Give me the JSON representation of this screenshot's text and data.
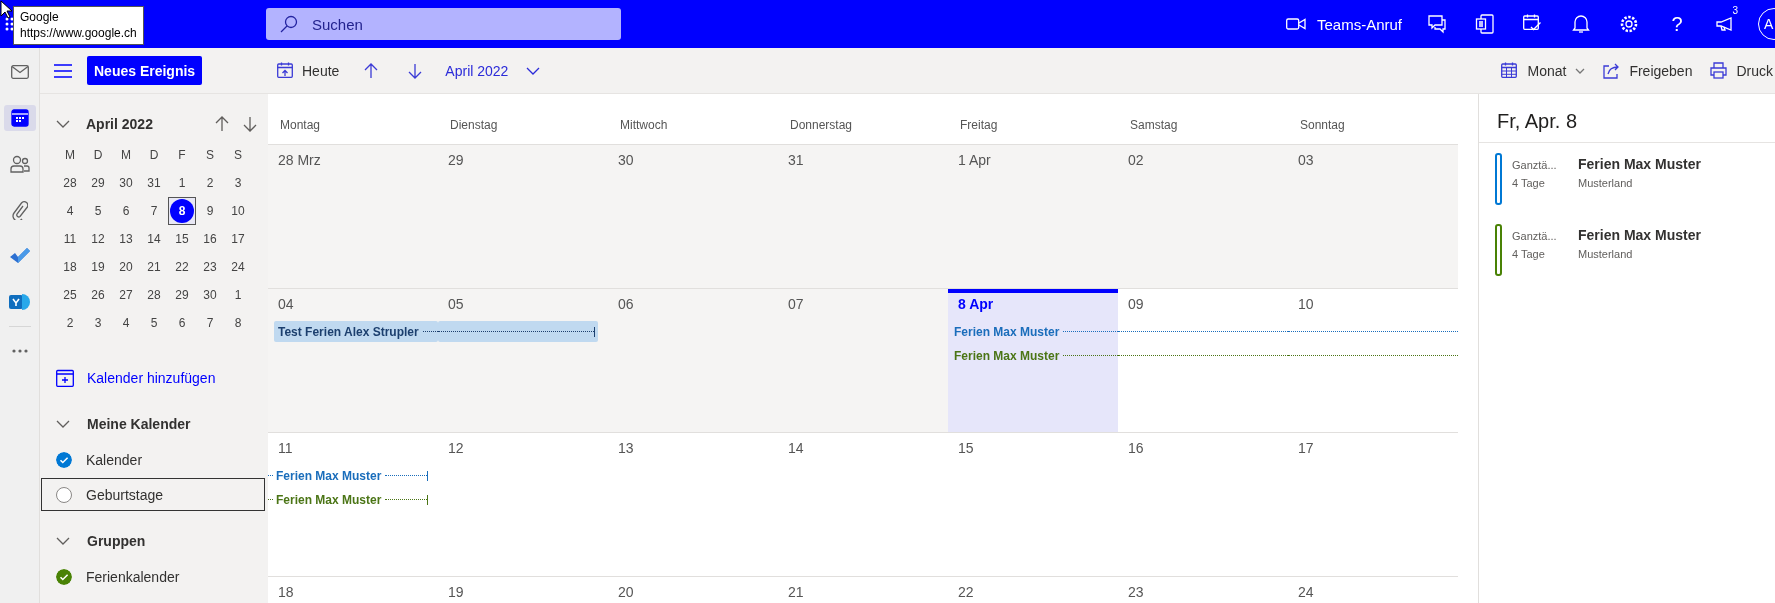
{
  "tooltip": {
    "title": "Google",
    "url": "https://www.google.ch"
  },
  "top_bar": {
    "search": {
      "placeholder": "Suchen"
    },
    "teams_call": "Teams-Anruf",
    "help": "?",
    "notification_count": "3",
    "avatar": "A"
  },
  "toolbar": {
    "new_event": "Neues Ereignis",
    "today": "Heute",
    "period": "April 2022",
    "view": "Monat",
    "share": "Freigeben",
    "print": "Druck"
  },
  "rail": [
    {
      "kind": "mail",
      "selected": false
    },
    {
      "kind": "calendar",
      "selected": true
    },
    {
      "kind": "people",
      "selected": false
    },
    {
      "kind": "files",
      "selected": false
    },
    {
      "kind": "todo",
      "selected": false
    },
    {
      "kind": "social",
      "selected": false
    },
    {
      "kind": "more",
      "selected": false
    }
  ],
  "mini_calendar": {
    "title": "April 2022",
    "weekdays": [
      "M",
      "D",
      "M",
      "D",
      "F",
      "S",
      "S"
    ],
    "weeks": [
      [
        {
          "label": "28",
          "selected": false
        },
        {
          "label": "29",
          "selected": false
        },
        {
          "label": "30",
          "selected": false
        },
        {
          "label": "31",
          "selected": false
        },
        {
          "label": "1",
          "selected": false
        },
        {
          "label": "2",
          "selected": false
        },
        {
          "label": "3",
          "selected": false
        }
      ],
      [
        {
          "label": "4",
          "selected": false
        },
        {
          "label": "5",
          "selected": false
        },
        {
          "label": "6",
          "selected": false
        },
        {
          "label": "7",
          "selected": false
        },
        {
          "label": "8",
          "selected": true
        },
        {
          "label": "9",
          "selected": false
        },
        {
          "label": "10",
          "selected": false
        }
      ],
      [
        {
          "label": "11",
          "selected": false
        },
        {
          "label": "12",
          "selected": false
        },
        {
          "label": "13",
          "selected": false
        },
        {
          "label": "14",
          "selected": false
        },
        {
          "label": "15",
          "selected": false
        },
        {
          "label": "16",
          "selected": false
        },
        {
          "label": "17",
          "selected": false
        }
      ],
      [
        {
          "label": "18",
          "selected": false
        },
        {
          "label": "19",
          "selected": false
        },
        {
          "label": "20",
          "selected": false
        },
        {
          "label": "21",
          "selected": false
        },
        {
          "label": "22",
          "selected": false
        },
        {
          "label": "23",
          "selected": false
        },
        {
          "label": "24",
          "selected": false
        }
      ],
      [
        {
          "label": "25",
          "selected": false
        },
        {
          "label": "26",
          "selected": false
        },
        {
          "label": "27",
          "selected": false
        },
        {
          "label": "28",
          "selected": false
        },
        {
          "label": "29",
          "selected": false
        },
        {
          "label": "30",
          "selected": false
        },
        {
          "label": "1",
          "selected": false
        }
      ],
      [
        {
          "label": "2",
          "selected": false
        },
        {
          "label": "3",
          "selected": false
        },
        {
          "label": "4",
          "selected": false
        },
        {
          "label": "5",
          "selected": false
        },
        {
          "label": "6",
          "selected": false
        },
        {
          "label": "7",
          "selected": false
        },
        {
          "label": "8",
          "selected": false
        }
      ]
    ]
  },
  "add_calendar": "Kalender hinzufügen",
  "calendar_groups": [
    {
      "title": "Meine Kalender",
      "expanded": true,
      "items": [
        {
          "name": "Kalender",
          "checked": true,
          "focused": false,
          "color": "#0078d4"
        },
        {
          "name": "Geburtstage",
          "checked": false,
          "focused": true
        }
      ]
    },
    {
      "title": "Gruppen",
      "expanded": true,
      "items": [
        {
          "name": "Ferienkalender",
          "checked": true,
          "focused": false,
          "color": "#498205"
        }
      ]
    }
  ],
  "month_grid": {
    "weekdays": [
      "Montag",
      "Dienstag",
      "Mittwoch",
      "Donnerstag",
      "Freitag",
      "Samstag",
      "Sonntag"
    ],
    "weeks": [
      {
        "days": [
          {
            "label": "28 Mrz",
            "past": true,
            "today": false
          },
          {
            "label": "29",
            "past": true,
            "today": false
          },
          {
            "label": "30",
            "past": true,
            "today": false
          },
          {
            "label": "31",
            "past": true,
            "today": false
          },
          {
            "label": "1 Apr",
            "past": true,
            "today": false
          },
          {
            "label": "02",
            "past": true,
            "today": false
          },
          {
            "label": "03",
            "past": true,
            "today": false
          }
        ]
      },
      {
        "days": [
          {
            "label": "04",
            "past": true,
            "today": false,
            "events": [
              {
                "title": "Test Ferien Alex Strupler",
                "kind": "filled",
                "color": "#c0d9f0",
                "continues_before": false,
                "continues_after": true
              }
            ]
          },
          {
            "label": "05",
            "past": true,
            "today": false,
            "events": [
              {
                "kind": "filled",
                "color": "#c0d9f0",
                "continues_before": true,
                "continues_after": false
              }
            ]
          },
          {
            "label": "06",
            "past": true,
            "today": false
          },
          {
            "label": "07",
            "past": true,
            "today": false
          },
          {
            "label": "8 Apr",
            "past": false,
            "today": true,
            "events": [
              {
                "title": "Ferien Max Muster",
                "kind": "line",
                "color": "#1a6dbb",
                "continues_before": false,
                "continues_after": true
              },
              {
                "title": "Ferien Max Muster",
                "kind": "line",
                "color": "#4b7516",
                "continues_before": false,
                "continues_after": true
              }
            ]
          },
          {
            "label": "09",
            "past": false,
            "today": false,
            "events": [
              {
                "kind": "line",
                "color": "#1a6dbb",
                "continues_before": true,
                "continues_after": true
              },
              {
                "kind": "line",
                "color": "#4b7516",
                "continues_before": true,
                "continues_after": true
              }
            ]
          },
          {
            "label": "10",
            "past": false,
            "today": false,
            "events": [
              {
                "kind": "line",
                "color": "#1a6dbb",
                "continues_before": true,
                "continues_after": true
              },
              {
                "kind": "line",
                "color": "#4b7516",
                "continues_before": true,
                "continues_after": true
              }
            ]
          }
        ]
      },
      {
        "days": [
          {
            "label": "11",
            "past": false,
            "today": false,
            "events": [
              {
                "title": "Ferien Max Muster",
                "kind": "line",
                "color": "#1a6dbb",
                "continues_before": true,
                "continues_after": false
              },
              {
                "title": "Ferien Max Muster",
                "kind": "line",
                "color": "#4b7516",
                "continues_before": true,
                "continues_after": false
              }
            ]
          },
          {
            "label": "12",
            "past": false,
            "today": false
          },
          {
            "label": "13",
            "past": false,
            "today": false
          },
          {
            "label": "14",
            "past": false,
            "today": false
          },
          {
            "label": "15",
            "past": false,
            "today": false
          },
          {
            "label": "16",
            "past": false,
            "today": false
          },
          {
            "label": "17",
            "past": false,
            "today": false
          }
        ]
      },
      {
        "days": [
          {
            "label": "18",
            "past": false,
            "today": false
          },
          {
            "label": "19",
            "past": false,
            "today": false
          },
          {
            "label": "20",
            "past": false,
            "today": false
          },
          {
            "label": "21",
            "past": false,
            "today": false
          },
          {
            "label": "22",
            "past": false,
            "today": false
          },
          {
            "label": "23",
            "past": false,
            "today": false
          },
          {
            "label": "24",
            "past": false,
            "today": false
          }
        ]
      }
    ]
  },
  "agenda": {
    "title": "Fr, Apr. 8",
    "items": [
      {
        "time": "Ganztä...",
        "duration": "4 Tage",
        "title": "Ferien Max Muster",
        "location": "Musterland",
        "color": "#0078d4"
      },
      {
        "time": "Ganztä...",
        "duration": "4 Tage",
        "title": "Ferien Max Muster",
        "location": "Musterland",
        "color": "#498205"
      }
    ]
  }
}
